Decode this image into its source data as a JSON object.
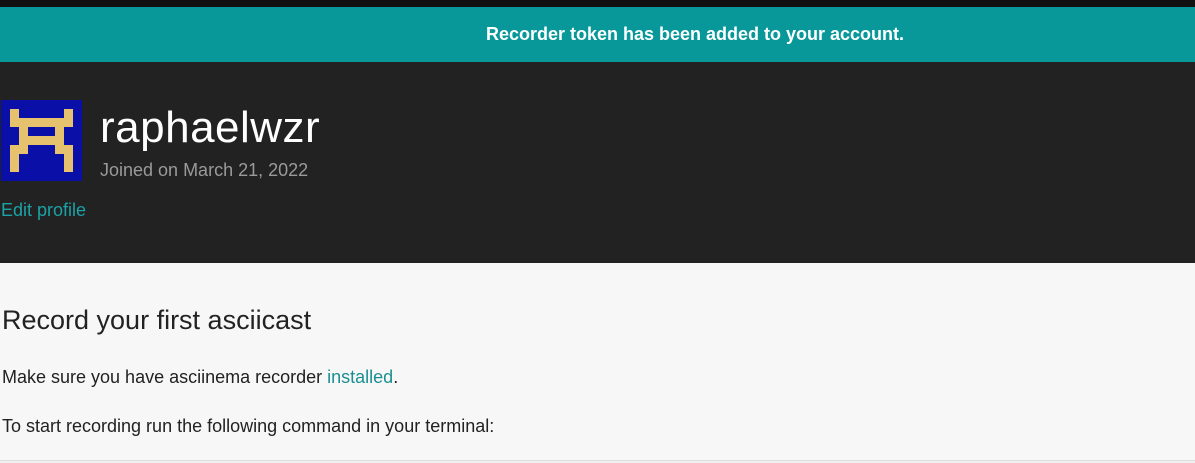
{
  "flash": {
    "message": "Recorder token has been added to your account."
  },
  "profile": {
    "username": "raphaelwzr",
    "joined": "Joined on March 21, 2022",
    "edit_link": "Edit profile",
    "avatar_colors": {
      "background": "#0a0fa8",
      "figure": "#e6c26e"
    }
  },
  "main": {
    "heading": "Record your first asciicast",
    "install_prefix": "Make sure you have asciinema recorder ",
    "install_link": "installed",
    "install_suffix": ".",
    "command_intro": "To start recording run the following command in your terminal:"
  },
  "colors": {
    "flash_bg": "#08989a",
    "header_bg": "#222222",
    "link": "#1aa3a6",
    "page_bg": "#f7f7f7"
  }
}
